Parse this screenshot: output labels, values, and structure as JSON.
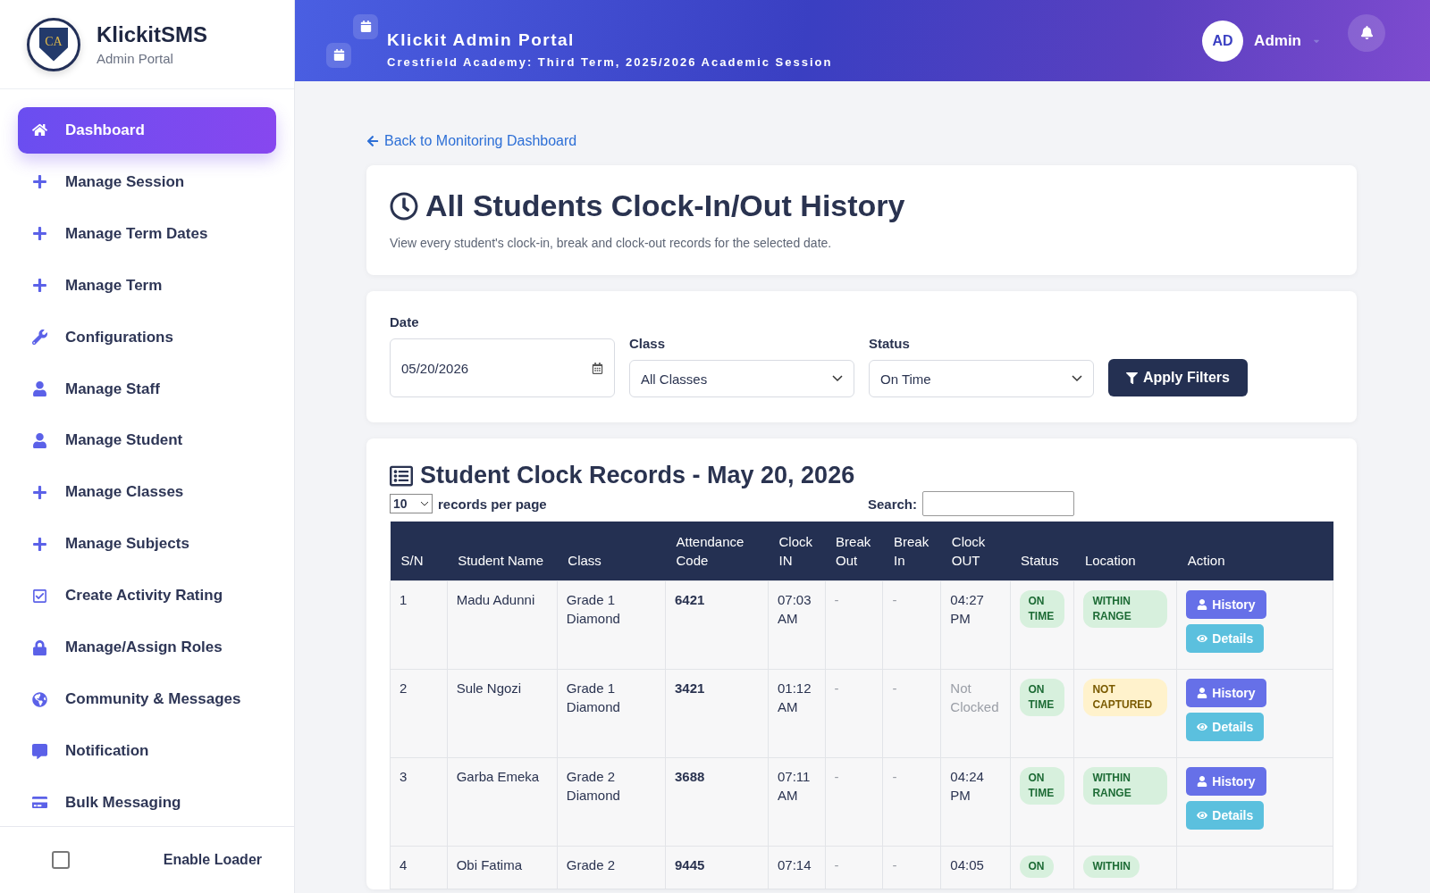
{
  "brand": {
    "logo": "CA",
    "name": "KlickitSMS",
    "subtitle": "Admin Portal"
  },
  "sidebar": {
    "items": [
      {
        "label": "Dashboard",
        "selected": true
      },
      {
        "label": "Manage Session",
        "selected": false
      },
      {
        "label": "Manage Term Dates",
        "selected": false
      },
      {
        "label": "Manage Term",
        "selected": false
      },
      {
        "label": "Configurations",
        "selected": false
      },
      {
        "label": "Manage Staff",
        "selected": false
      },
      {
        "label": "Manage Student",
        "selected": false
      },
      {
        "label": "Manage Classes",
        "selected": false
      },
      {
        "label": "Manage Subjects",
        "selected": false
      },
      {
        "label": "Create Activity Rating",
        "selected": false
      },
      {
        "label": "Manage/Assign Roles",
        "selected": false
      },
      {
        "label": "Community & Messages",
        "selected": false
      },
      {
        "label": "Notification",
        "selected": false
      },
      {
        "label": "Bulk Messaging",
        "selected": false
      }
    ],
    "footer": {
      "label": "Enable Loader",
      "checked": false
    }
  },
  "header": {
    "title": "Klickit Admin Portal",
    "subtitle": "Crestfield Academy: Third Term, 2025/2026 Academic Session",
    "avatar": "AD",
    "user": "Admin"
  },
  "back_link": "Back to Monitoring Dashboard",
  "page": {
    "title": "All Students Clock-In/Out History",
    "description": "View every student's clock-in, break and clock-out records for the selected date."
  },
  "filters": {
    "date": {
      "label": "Date",
      "value": "05/20/2026"
    },
    "class": {
      "label": "Class",
      "value": "All Classes"
    },
    "status": {
      "label": "Status",
      "value": "On Time"
    },
    "button": "Apply Filters"
  },
  "records": {
    "title": "Student Clock Records - May 20, 2026",
    "per_page": "10",
    "per_page_label": "records per page",
    "search_label": "Search:",
    "columns": [
      "S/N",
      "Student Name",
      "Class",
      "Attendance Code",
      "Clock IN",
      "Break Out",
      "Break In",
      "Clock OUT",
      "Status",
      "Location",
      "Action"
    ],
    "rows": [
      {
        "sn": "1",
        "name": "Madu Adunni",
        "class": "Grade 1 Diamond",
        "code": "6421",
        "clock_in": "07:03 AM",
        "break_out": "-",
        "break_in": "-",
        "clock_out": "04:27 PM",
        "clocked_out": true,
        "status": "ON TIME",
        "location": {
          "label": "WITHIN RANGE",
          "color": "#d7f0dd"
        },
        "actions": [
          "History",
          "Details"
        ]
      },
      {
        "sn": "2",
        "name": "Sule Ngozi",
        "class": "Grade 1 Diamond",
        "code": "3421",
        "clock_in": "01:12 AM",
        "break_out": "-",
        "break_in": "-",
        "clock_out": "Not Clocked",
        "clocked_out": false,
        "status": "ON TIME",
        "location": {
          "label": "NOT CAPTURED",
          "color": "#fff2cc"
        },
        "actions": [
          "History",
          "Details"
        ]
      },
      {
        "sn": "3",
        "name": "Garba Emeka",
        "class": "Grade 2 Diamond",
        "code": "3688",
        "clock_in": "07:11 AM",
        "break_out": "-",
        "break_in": "-",
        "clock_out": "04:24 PM",
        "clocked_out": true,
        "status": "ON TIME",
        "location": {
          "label": "WITHIN RANGE",
          "color": "#d7f0dd"
        },
        "actions": [
          "History",
          "Details"
        ]
      },
      {
        "sn": "4",
        "name": "Obi Fatima",
        "class": "Grade 2",
        "code": "9445",
        "clock_in": "07:14",
        "break_out": "-",
        "break_in": "-",
        "clock_out": "04:05",
        "clocked_out": true,
        "status": "ON",
        "location": {
          "label": "WITHIN",
          "color": "#d7f0dd"
        },
        "actions": []
      }
    ]
  }
}
